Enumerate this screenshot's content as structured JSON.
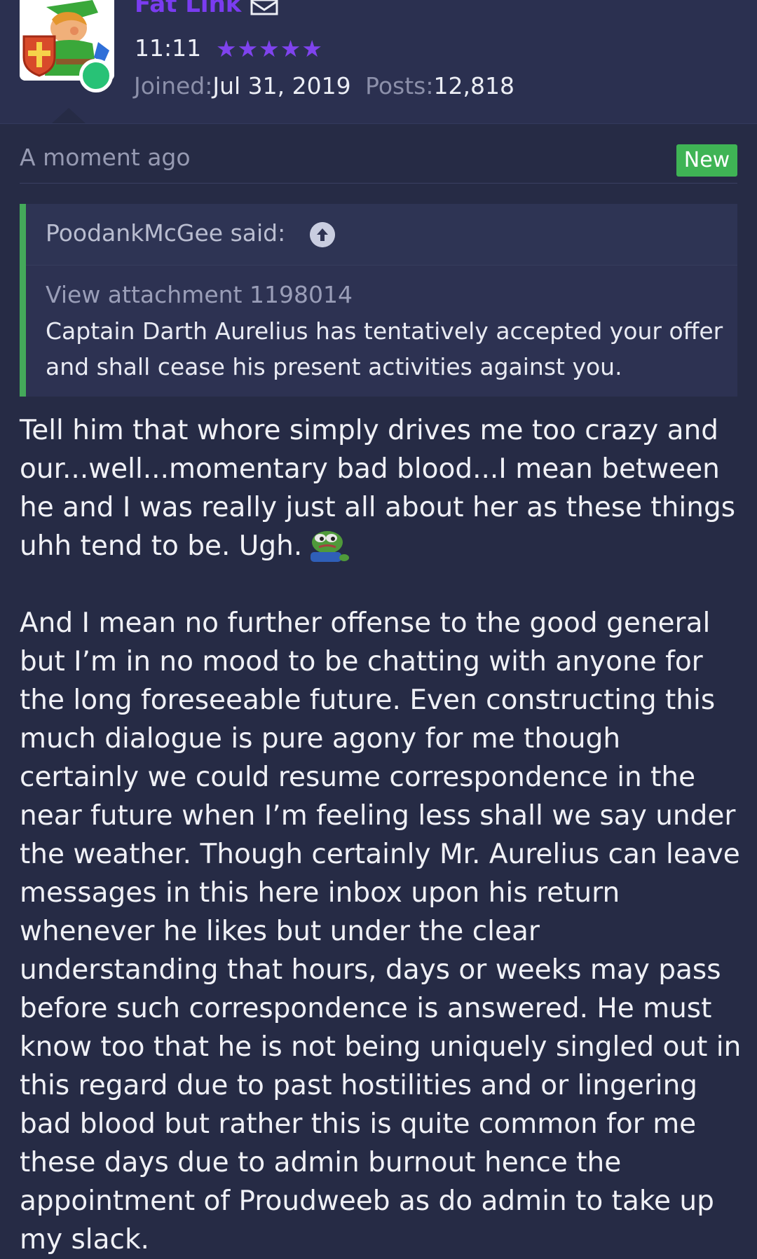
{
  "user": {
    "name": "Fat Link",
    "title": "11:11",
    "stars": "★★★★★",
    "joined_label": "Joined:",
    "joined_value": "Jul 31, 2019",
    "posts_label": "Posts:",
    "posts_value": "12,818"
  },
  "post": {
    "time": "A moment ago",
    "badge": "New",
    "quote": {
      "author": "PoodankMcGee said:",
      "attachment": "View attachment 1198014",
      "text": "Captain Darth Aurelius has tentatively accepted your offer and shall cease his present activities against you."
    },
    "body": [
      "Tell him that whore simply drives me too crazy and our...well...momentary bad blood...I mean between he and I was really just all about her as these things uhh tend to be. Ugh.",
      "And I mean no further offense to the good general but I’m in no mood to be chatting with anyone for the long foreseeable future. Even constructing this much dialogue is pure agony for me though certainly we could resume correspondence in the near future when I’m feeling less shall we say under the weather. Though certainly Mr. Aurelius can leave messages in this here inbox upon his return whenever he likes but under the clear understanding that hours, days or weeks may pass before such correspondence is answered. He must know too that he is not being uniquely singled out in this regard due to past hostilities and or lingering bad blood but rather this is quite common for me these days due to admin burnout hence the appointment of Proudweeb as do admin to take up my slack."
    ],
    "emoji": "pepe-sad-emoji"
  },
  "colors": {
    "background": "#262b45",
    "username": "#7a3cf0",
    "stars": "#7f43ee",
    "online": "#28c276",
    "new_badge": "#3fb455",
    "quote_bar": "#44a95a"
  }
}
